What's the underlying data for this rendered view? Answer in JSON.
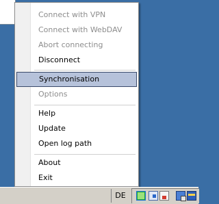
{
  "menu": {
    "items": [
      {
        "label": "Connect with VPN",
        "enabled": false
      },
      {
        "label": "Connect with WebDAV",
        "enabled": false
      },
      {
        "label": "Abort connecting",
        "enabled": false
      },
      {
        "label": "Disconnect",
        "enabled": true
      },
      {
        "label": "Synchronisation",
        "enabled": true,
        "highlighted": true
      },
      {
        "label": "Options",
        "enabled": false
      },
      {
        "label": "Help",
        "enabled": true
      },
      {
        "label": "Update",
        "enabled": true
      },
      {
        "label": "Open log path",
        "enabled": true
      },
      {
        "label": "About",
        "enabled": true
      },
      {
        "label": "Exit",
        "enabled": true
      }
    ]
  },
  "taskbar": {
    "language": "DE",
    "tray_icons": [
      "sync-tray-icon",
      "network-tray-icon",
      "app-tray-icon",
      "computer-tray-icon",
      "security-tray-icon"
    ]
  },
  "colors": {
    "desktop": "#3a6ea5",
    "highlight": "#b6c2da",
    "disabled_text": "#8d8d8d"
  }
}
